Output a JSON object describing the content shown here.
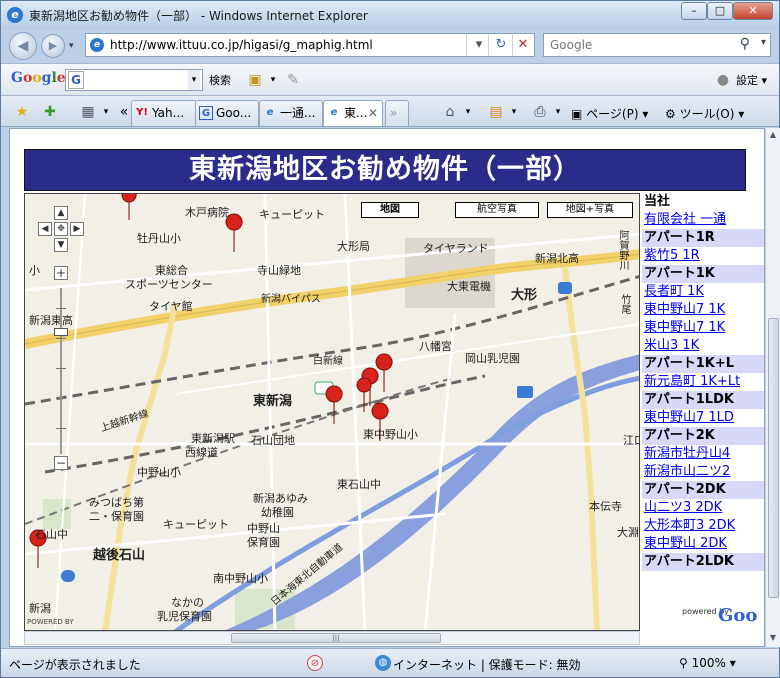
{
  "window": {
    "title": "東新潟地区お勧め物件（一部） - Windows Internet Explorer",
    "min": "–",
    "max": "□",
    "close": "✕"
  },
  "address_bar": {
    "url": "http://www.ittuu.co.jp/higasi/g_maphig.html",
    "search_placeholder": "Google"
  },
  "google_toolbar": {
    "logo": [
      "G",
      "o",
      "o",
      "g",
      "l",
      "e"
    ],
    "search_button": "検索",
    "settings": "設定"
  },
  "tabs": [
    {
      "label": "Yah...",
      "icon": "Y!"
    },
    {
      "label": "Goo...",
      "icon": "G"
    },
    {
      "label": "一通...",
      "icon": "e"
    },
    {
      "label": "東...",
      "icon": "e",
      "active": true
    }
  ],
  "command_bar": {
    "page": "ページ(P)",
    "tools": "ツール(O)"
  },
  "page": {
    "title": "東新潟地区お勧め物件（一部）"
  },
  "map": {
    "type_buttons": [
      "地図",
      "航空写真",
      "地図+写真"
    ],
    "labels": [
      "木戸病院",
      "キューピット",
      "牡丹山小",
      "寺山緑地",
      "東総合",
      "スポーツセンター",
      "タイヤ館",
      "新潟バイパス",
      "新潟東高",
      "大形局",
      "タイヤランド",
      "新潟北高",
      "大東電機",
      "大形",
      "阿賀野川",
      "竹尾",
      "八幡宮",
      "岡山乳児園",
      "東新潟",
      "白新線",
      "上越新幹線",
      "東新潟駅",
      "西線道",
      "石山団地",
      "中野山小",
      "東石山中",
      "新潟あゆみ",
      "幼稚園",
      "みつばち第",
      "二・保育園",
      "キューピット",
      "中野山",
      "保育園",
      "越後石山",
      "石山中",
      "南中野山小",
      "なかの",
      "乳児保育園",
      "新潟",
      "日本海東北自動車道",
      "本伝寺",
      "大淵",
      "江口",
      "東中野山小",
      "大形本町",
      "小"
    ],
    "poweredby": "POWERED BY"
  },
  "sidebar": {
    "sections": [
      {
        "head": "当社",
        "links": [
          "有限会社 一通"
        ]
      },
      {
        "head": "アパート1R",
        "links": [
          "紫竹5 1R"
        ]
      },
      {
        "head": "アパート1K",
        "links": [
          "長者町 1K",
          "東中野山7 1K",
          "東中野山7 1K",
          "米山3 1K"
        ]
      },
      {
        "head": "アパート1K+L",
        "links": [
          "新元島町 1K+Lt"
        ]
      },
      {
        "head": "アパート1LDK",
        "links": [
          "東中野山7 1LD"
        ]
      },
      {
        "head": "アパート2K",
        "links": [
          "新潟市牡丹山4",
          "新潟市山二ツ2"
        ]
      },
      {
        "head": "アパート2DK",
        "links": [
          "山二ツ3 2DK",
          "大形本町3 2DK",
          "東中野山 2DK"
        ]
      },
      {
        "head": "アパート2LDK",
        "links": []
      }
    ],
    "powered_small": "powered by",
    "powered_logo": "Goo"
  },
  "status": {
    "text": "ページが表示されました",
    "zone": "インターネット | 保護モード: 無効",
    "zoom": "100%"
  },
  "colors": {
    "title_bg": "#2b2b8c",
    "sidebar_head_bg": "#d8d8f8",
    "link": "#0000ee",
    "marker": "#d8231c",
    "expressway": "#7e9ee0",
    "main_road": "#f4d36a"
  }
}
